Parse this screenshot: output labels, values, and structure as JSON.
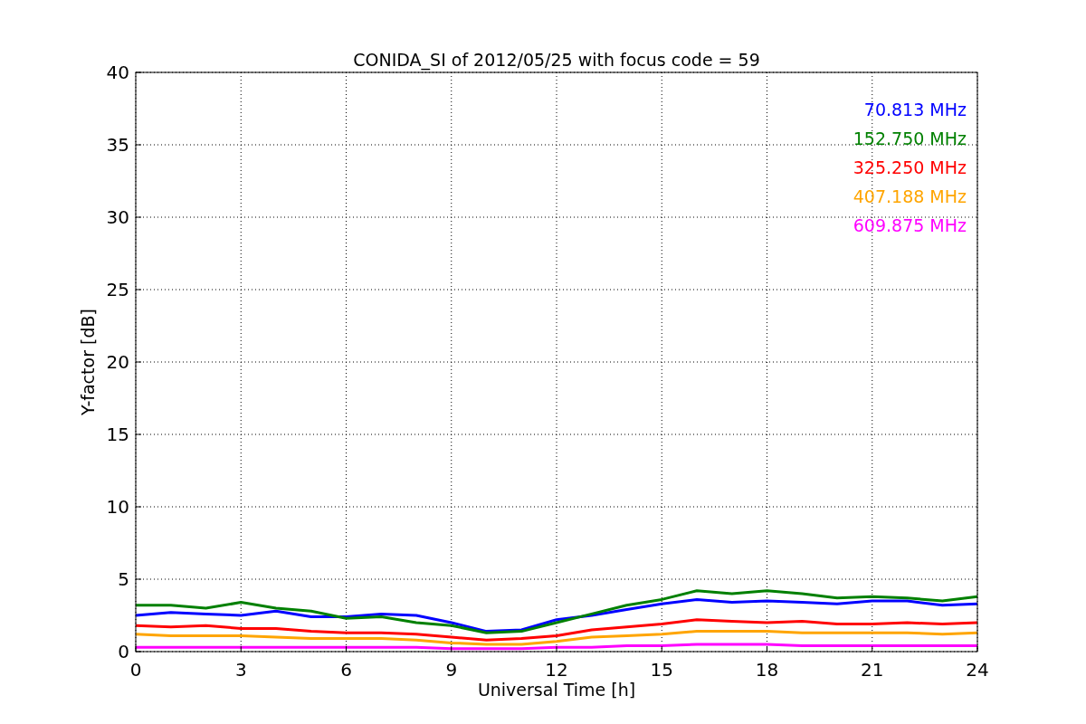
{
  "plot": {
    "chart_data": {
      "type": "line",
      "title": "CONIDA_SI of 2012/05/25 with focus code = 59",
      "xlabel": "Universal Time [h]",
      "ylabel": "Y-factor [dB]",
      "x": [
        0,
        1,
        2,
        3,
        4,
        5,
        6,
        7,
        8,
        9,
        10,
        11,
        12,
        13,
        14,
        15,
        16,
        17,
        18,
        19,
        20,
        21,
        22,
        23,
        24
      ],
      "series": [
        {
          "name": "70.813 MHz",
          "color": "#0000ff",
          "values": [
            2.5,
            2.7,
            2.6,
            2.5,
            2.8,
            2.4,
            2.4,
            2.6,
            2.5,
            2.0,
            1.4,
            1.5,
            2.2,
            2.5,
            2.9,
            3.3,
            3.6,
            3.4,
            3.5,
            3.4,
            3.3,
            3.5,
            3.5,
            3.2,
            3.3
          ]
        },
        {
          "name": "152.750 MHz",
          "color": "#008000",
          "values": [
            3.2,
            3.2,
            3.0,
            3.4,
            3.0,
            2.8,
            2.3,
            2.4,
            2.0,
            1.8,
            1.3,
            1.4,
            2.0,
            2.6,
            3.2,
            3.6,
            4.2,
            4.0,
            4.2,
            4.0,
            3.7,
            3.8,
            3.7,
            3.5,
            3.8
          ]
        },
        {
          "name": "325.250 MHz",
          "color": "#ff0000",
          "values": [
            1.8,
            1.7,
            1.8,
            1.6,
            1.6,
            1.4,
            1.3,
            1.3,
            1.2,
            1.0,
            0.8,
            0.9,
            1.1,
            1.5,
            1.7,
            1.9,
            2.2,
            2.1,
            2.0,
            2.1,
            1.9,
            1.9,
            2.0,
            1.9,
            2.0
          ]
        },
        {
          "name": "407.188 MHz",
          "color": "#ffa500",
          "values": [
            1.2,
            1.1,
            1.1,
            1.1,
            1.0,
            0.9,
            0.9,
            0.9,
            0.8,
            0.6,
            0.5,
            0.5,
            0.7,
            1.0,
            1.1,
            1.2,
            1.4,
            1.4,
            1.4,
            1.3,
            1.3,
            1.3,
            1.3,
            1.2,
            1.3
          ]
        },
        {
          "name": "609.875 MHz",
          "color": "#ff00ff",
          "values": [
            0.3,
            0.3,
            0.3,
            0.3,
            0.3,
            0.3,
            0.3,
            0.3,
            0.3,
            0.2,
            0.2,
            0.2,
            0.3,
            0.3,
            0.4,
            0.4,
            0.5,
            0.5,
            0.5,
            0.4,
            0.4,
            0.4,
            0.4,
            0.4,
            0.4
          ]
        }
      ],
      "xlim": [
        0,
        24
      ],
      "ylim": [
        0,
        40
      ],
      "xticks": [
        0,
        3,
        6,
        9,
        12,
        15,
        18,
        21,
        24
      ],
      "yticks": [
        0,
        5,
        10,
        15,
        20,
        25,
        30,
        35,
        40
      ],
      "grid": true
    }
  }
}
